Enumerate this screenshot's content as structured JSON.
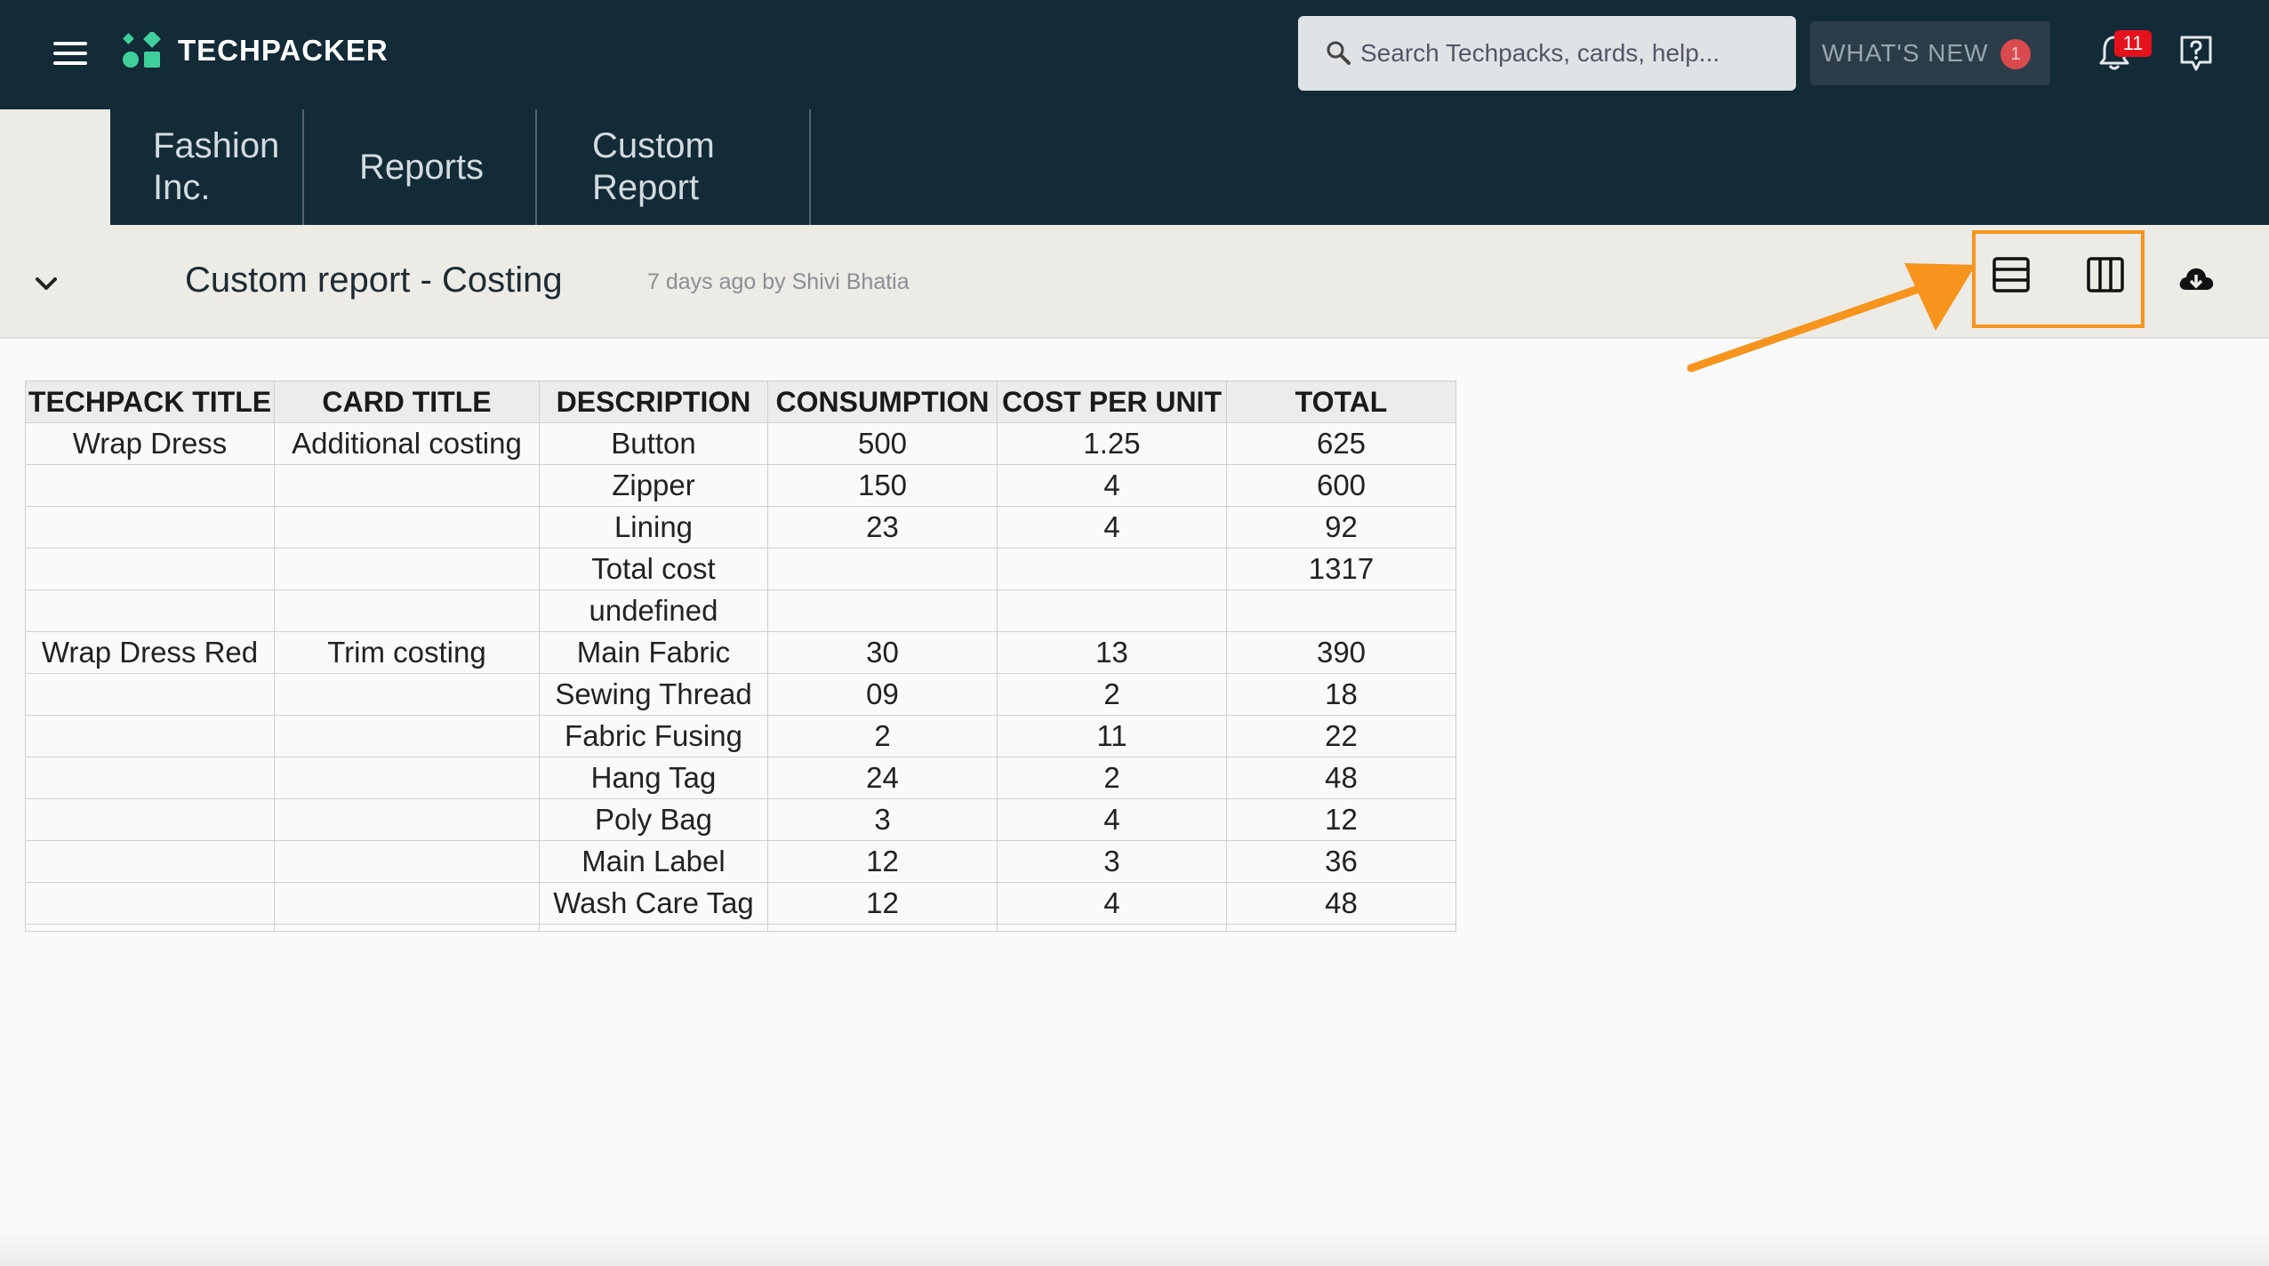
{
  "app": {
    "brand": "TECHPACKER"
  },
  "search": {
    "placeholder": "Search Techpacks, cards, help..."
  },
  "whats_new": {
    "label": "WHAT'S NEW",
    "count": "1"
  },
  "notifications": {
    "count": "11"
  },
  "icons": {
    "menu": "hamburger-icon",
    "search": "magnifier-icon",
    "bell": "bell-icon",
    "help": "help-bubble-icon",
    "collapse": "chevron-down-icon",
    "row_view": "rows-layout-icon",
    "column_view": "columns-layout-icon",
    "download": "cloud-download-icon"
  },
  "colors": {
    "navbar": "#132a37",
    "accent_highlight": "#f7941e",
    "badge": "#e3121c",
    "logo": "#3ecf9b"
  },
  "breadcrumbs": [
    {
      "line1": "Fashion",
      "line2": "Inc."
    },
    {
      "line1": "Reports",
      "line2": ""
    },
    {
      "line1": "Custom",
      "line2": "Report"
    }
  ],
  "report": {
    "title": "Custom report - Costing",
    "meta": "7 days ago by Shivi Bhatia"
  },
  "table": {
    "headers": [
      "TECHPACK TITLE",
      "CARD TITLE",
      "DESCRIPTION",
      "CONSUMPTION",
      "COST PER UNIT",
      "TOTAL"
    ],
    "rows": [
      [
        "Wrap Dress",
        "Additional costing",
        "Button",
        "500",
        "1.25",
        "625"
      ],
      [
        "",
        "",
        "Zipper",
        "150",
        "4",
        "600"
      ],
      [
        "",
        "",
        "Lining",
        "23",
        "4",
        "92"
      ],
      [
        "",
        "",
        "Total cost",
        "",
        "",
        "1317"
      ],
      [
        "",
        "",
        "undefined",
        "",
        "",
        ""
      ],
      [
        "Wrap Dress Red",
        "Trim costing",
        "Main Fabric",
        "30",
        "13",
        "390"
      ],
      [
        "",
        "",
        "Sewing Thread",
        "09",
        "2",
        "18"
      ],
      [
        "",
        "",
        "Fabric Fusing",
        "2",
        "11",
        "22"
      ],
      [
        "",
        "",
        "Hang Tag",
        "24",
        "2",
        "48"
      ],
      [
        "",
        "",
        "Poly Bag",
        "3",
        "4",
        "12"
      ],
      [
        "",
        "",
        "Main Label",
        "12",
        "3",
        "36"
      ],
      [
        "",
        "",
        "Wash Care Tag",
        "12",
        "4",
        "48"
      ]
    ]
  }
}
